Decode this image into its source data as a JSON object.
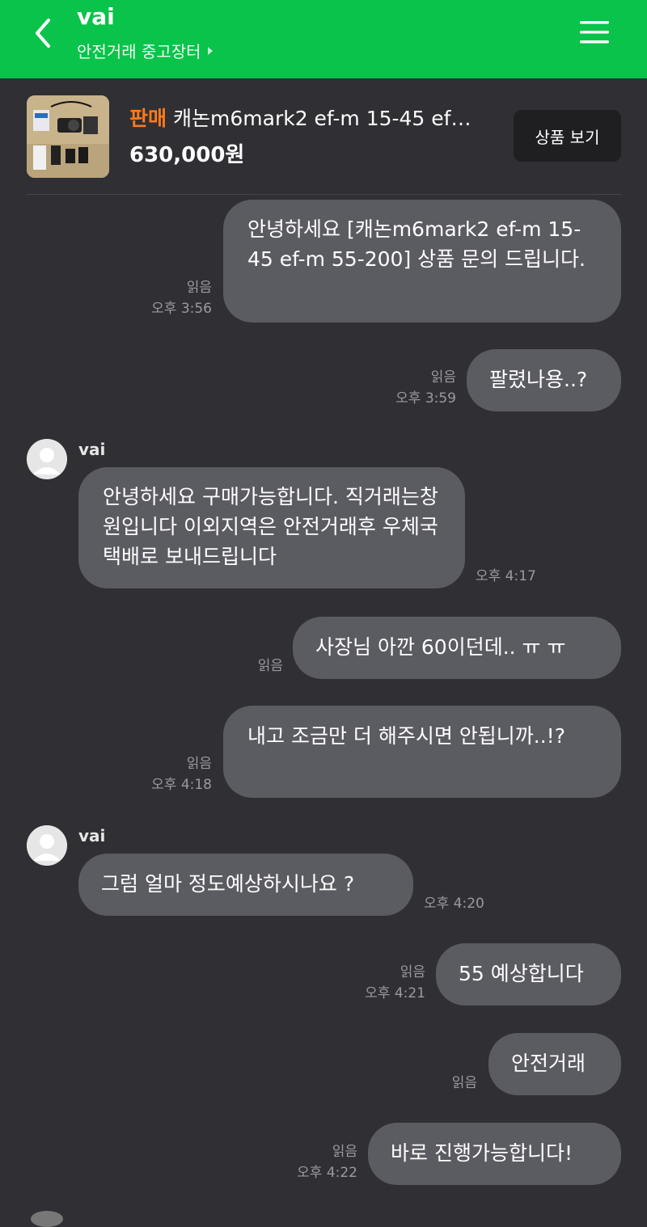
{
  "header": {
    "title": "vai",
    "subtitle": "안전거래 중고장터",
    "color": "#0ac34a"
  },
  "product": {
    "tag": "판매",
    "name": "캐논m6mark2 ef-m 15-45 ef…",
    "price": "630,000원",
    "view_button": "상품 보기"
  },
  "messages": [
    {
      "from": "me",
      "text": "안녕하세요 [캐논m6mark2  ef-m 15-45  ef-m 55-200] 상품 문의 드립니다.",
      "read": "읽음",
      "time": "오후 3:56"
    },
    {
      "from": "me",
      "text": "팔렸나용..?",
      "read": "읽음",
      "time": "오후 3:59"
    },
    {
      "from": "other",
      "sender": "vai",
      "text": "안녕하세요 구매가능합니다. 직거래는창원입니다 이외지역은 안전거래후 우체국택배로 보내드립니다",
      "time": "오후 4:17"
    },
    {
      "from": "me",
      "text": "사장님 아깐 60이던데.. ㅠ ㅠ",
      "read": "읽음",
      "time": ""
    },
    {
      "from": "me",
      "text": "내고 조금만 더 해주시면 안됩니까..!?",
      "read": "읽음",
      "time": "오후 4:18"
    },
    {
      "from": "other",
      "sender": "vai",
      "text": "그럼 얼마 정도예상하시나요 ?",
      "time": "오후 4:20"
    },
    {
      "from": "me",
      "text": "55 예상합니다",
      "read": "읽음",
      "time": "오후 4:21"
    },
    {
      "from": "me",
      "text": "안전거래",
      "read": "읽음",
      "time": ""
    },
    {
      "from": "me",
      "text": "바로 진행가능합니다!",
      "read": "읽음",
      "time": "오후 4:22"
    }
  ]
}
